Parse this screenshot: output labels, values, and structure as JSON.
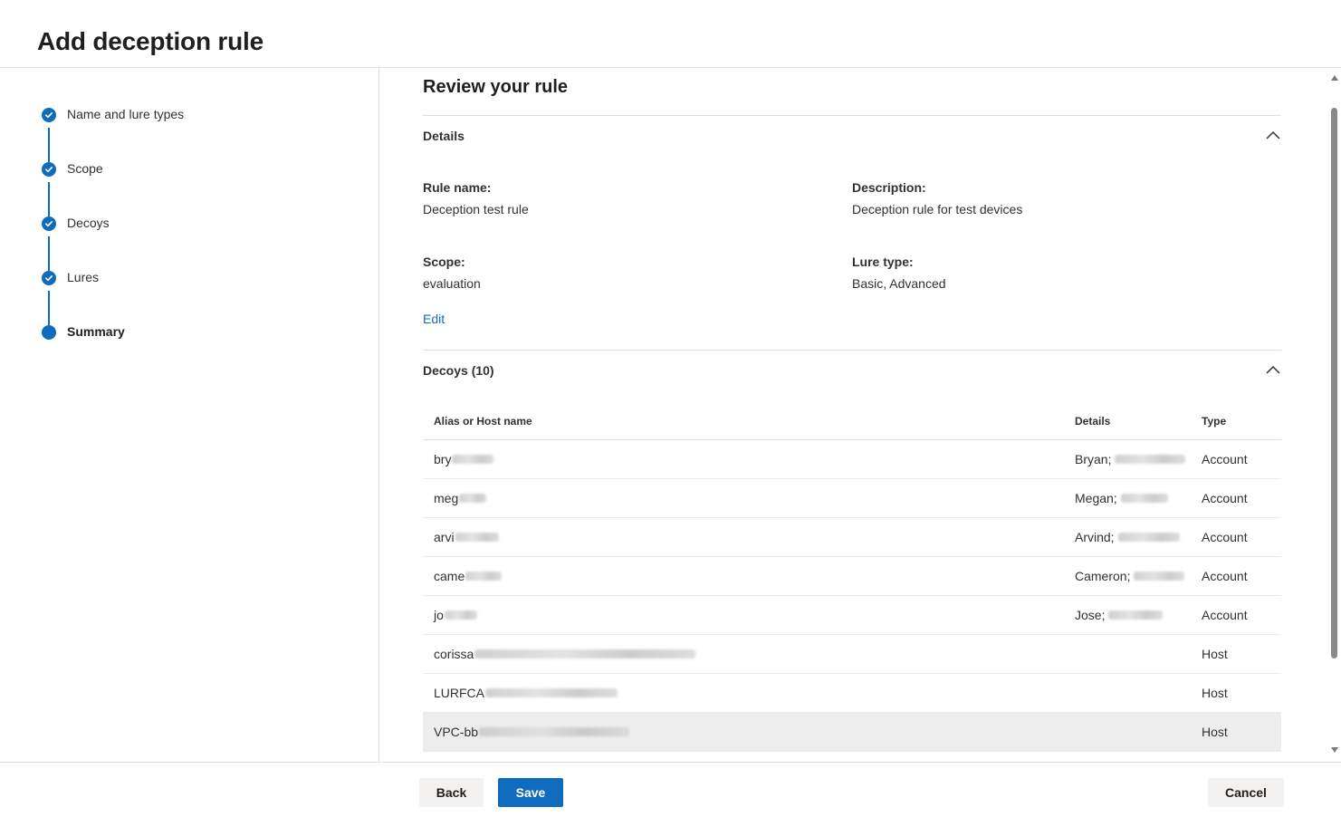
{
  "page_title": "Add deception rule",
  "steps": [
    {
      "label": "Name and lure types",
      "state": "complete"
    },
    {
      "label": "Scope",
      "state": "complete"
    },
    {
      "label": "Decoys",
      "state": "complete"
    },
    {
      "label": "Lures",
      "state": "complete"
    },
    {
      "label": "Summary",
      "state": "current"
    }
  ],
  "review": {
    "title": "Review your rule",
    "details": {
      "header": "Details",
      "rule_name_label": "Rule name:",
      "rule_name_value": "Deception test rule",
      "description_label": "Description:",
      "description_value": "Deception rule for test devices",
      "scope_label": "Scope:",
      "scope_value": "evaluation",
      "lure_type_label": "Lure type:",
      "lure_type_value": "Basic, Advanced",
      "edit_label": "Edit"
    },
    "decoys": {
      "header": "Decoys (10)",
      "columns": [
        "Alias or Host name",
        "Details",
        "Type"
      ],
      "rows": [
        {
          "alias": "bry",
          "details": "Bryan;",
          "type": "Account"
        },
        {
          "alias": "meg",
          "details": "Megan;",
          "type": "Account"
        },
        {
          "alias": "arvi",
          "details": "Arvind;",
          "type": "Account"
        },
        {
          "alias": "came",
          "details": "Cameron;",
          "type": "Account"
        },
        {
          "alias": "jo",
          "details": "Jose;",
          "type": "Account"
        },
        {
          "alias": "corissa",
          "details": "",
          "type": "Host"
        },
        {
          "alias": "LURFCA",
          "details": "",
          "type": "Host"
        },
        {
          "alias": "VPC-bb",
          "details": "",
          "type": "Host"
        }
      ]
    }
  },
  "footer": {
    "back_label": "Back",
    "save_label": "Save",
    "cancel_label": "Cancel"
  },
  "colors": {
    "accent": "#0f6cbd",
    "divider": "#e1dfdd",
    "selected_row": "#ededed"
  }
}
